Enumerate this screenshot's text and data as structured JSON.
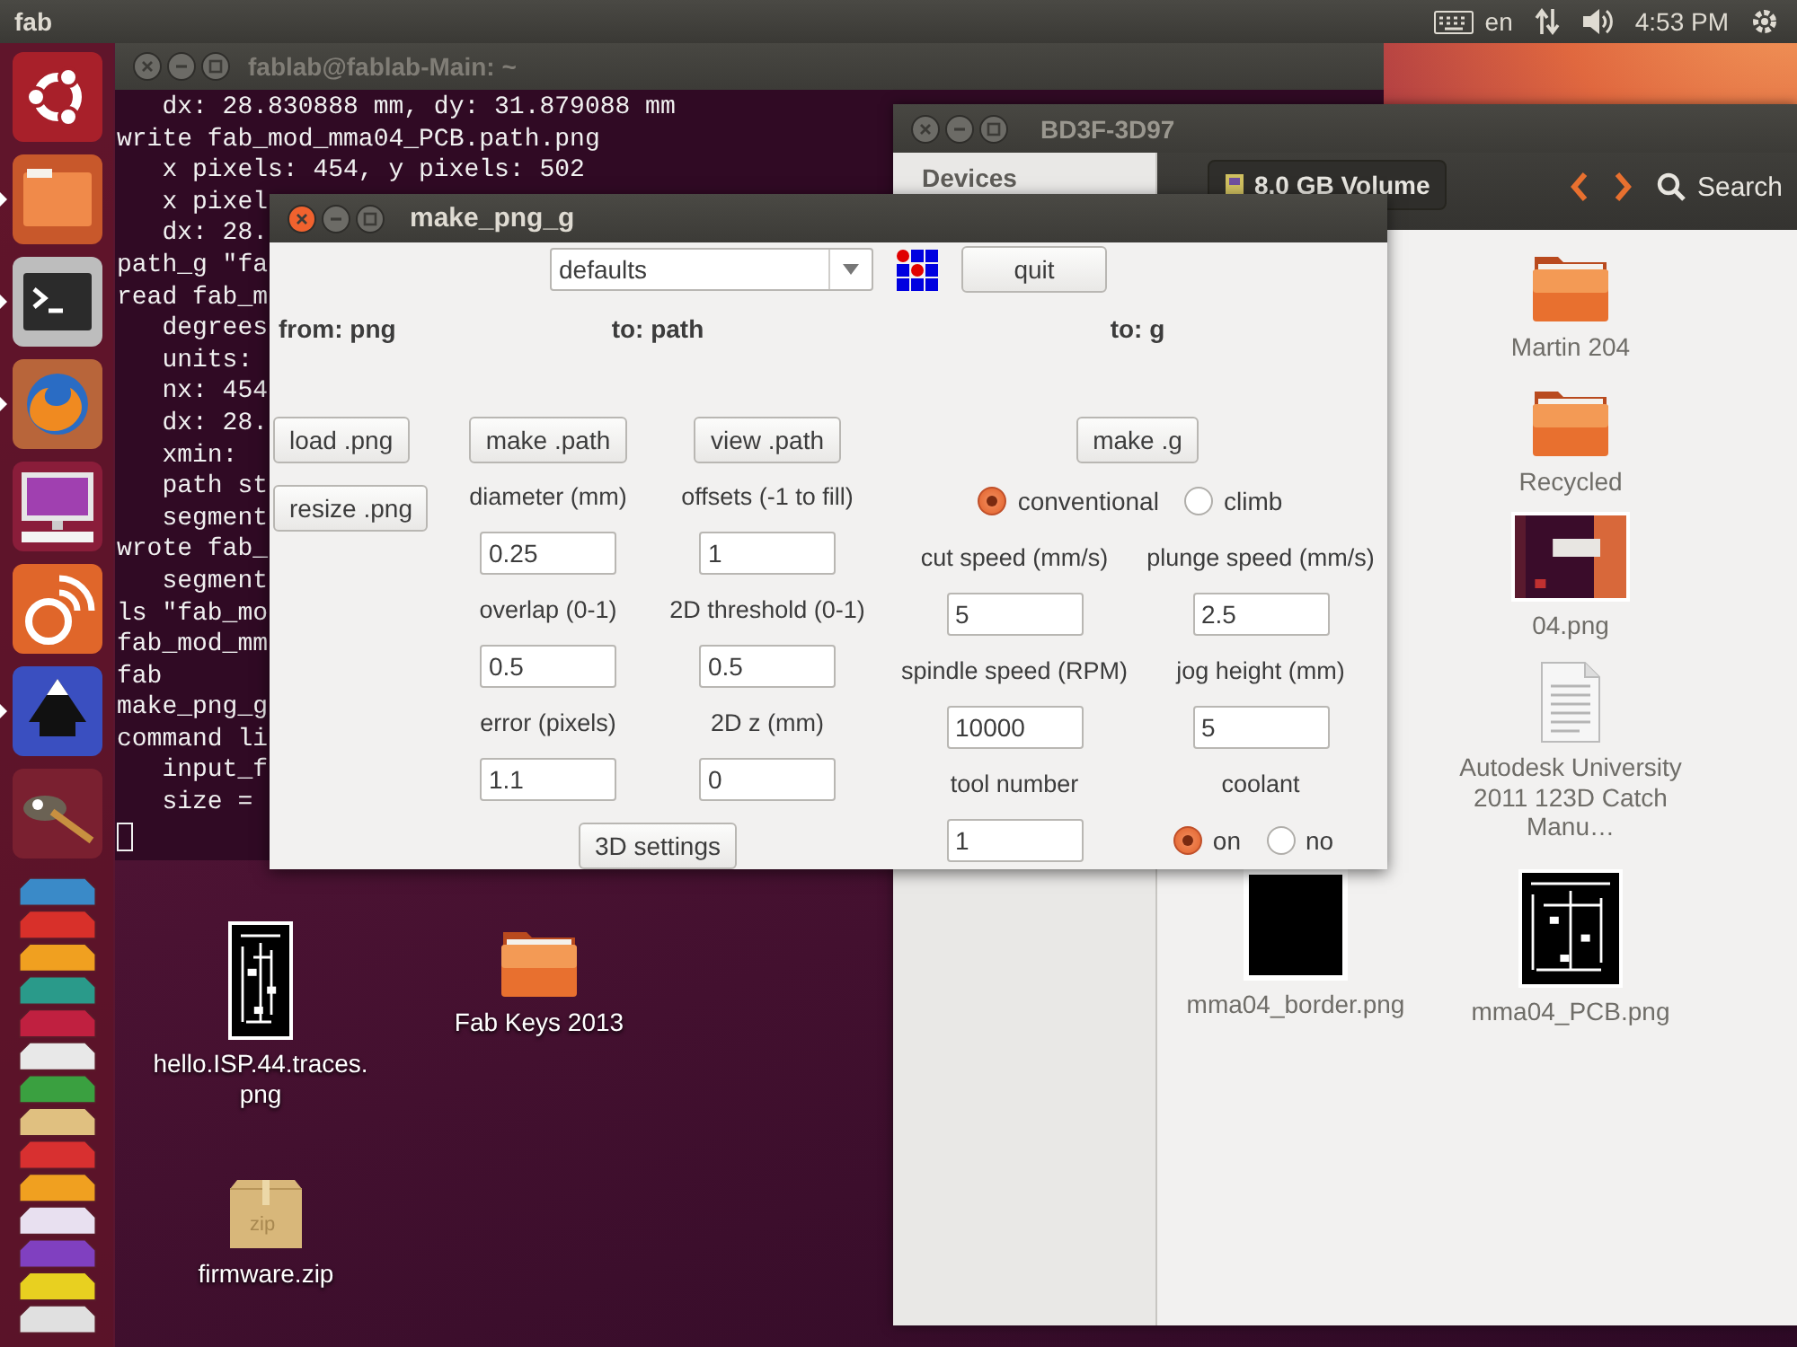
{
  "top_panel": {
    "title": "fab",
    "language": "en",
    "clock": "4:53 PM"
  },
  "launcher": [
    {
      "kind": "home",
      "running": false
    },
    {
      "kind": "files",
      "running": true
    },
    {
      "kind": "terminal",
      "running": true
    },
    {
      "kind": "browser",
      "running": true
    },
    {
      "kind": "display",
      "running": false
    },
    {
      "kind": "chat",
      "running": false
    },
    {
      "kind": "vector",
      "running": true
    },
    {
      "kind": "paint",
      "running": false
    }
  ],
  "terminal": {
    "title": "fablab@fablab-Main: ~",
    "lines": [
      "   dx: 28.830888 mm, dy: 31.879088 mm",
      "write fab_mod_mma04_PCB.path.png",
      "   x pixels: 454, y pixels: 502",
      "   x pixel",
      "   dx: 28.",
      "path_g \"fa",
      "read fab_m",
      "   degrees",
      "   units:",
      "   nx: 454",
      "   dx: 28.",
      "   xmin:",
      "   path st",
      "   segment",
      "wrote fab_",
      "   segment",
      "ls \"fab_mo",
      "fab_mod_mm",
      "fab",
      "make_png_g",
      "command li",
      "   input_f",
      "   size ="
    ]
  },
  "file_manager": {
    "title": "BD3F-3D97",
    "sidebar_heading": "Devices",
    "location": "8.0 GB Volume",
    "search": "Search",
    "items": [
      {
        "name": "Martin 204",
        "kind": "folder"
      },
      {
        "name": "Recycled",
        "kind": "folder"
      },
      {
        "name": "04.png",
        "kind": "screenshot"
      },
      {
        "name": "Autodesk University 2011 123D Catch Manu…",
        "kind": "document"
      },
      {
        "name": "mma04_border.png",
        "kind": "blank-image"
      },
      {
        "name": "mma04_PCB.png",
        "kind": "circuit-image"
      }
    ]
  },
  "dialog": {
    "title": "make_png_g",
    "preset": "defaults",
    "quit": "quit",
    "headers": [
      "from: png",
      "to: path",
      "to: g"
    ],
    "png_buttons": [
      "load .png",
      "resize .png"
    ],
    "path": {
      "buttons": [
        "make .path",
        "view .path"
      ],
      "fields": [
        {
          "label": "diameter (mm)",
          "value": "0.25"
        },
        {
          "label": "offsets (-1 to fill)",
          "value": "1"
        },
        {
          "label": "overlap (0-1)",
          "value": "0.5"
        },
        {
          "label": "2D threshold (0-1)",
          "value": "0.5"
        },
        {
          "label": "error (pixels)",
          "value": "1.1"
        },
        {
          "label": "2D z (mm)",
          "value": "0"
        }
      ],
      "settings_button": "3D settings"
    },
    "g": {
      "button": "make .g",
      "direction": [
        {
          "label": "conventional",
          "selected": true
        },
        {
          "label": "climb",
          "selected": false
        }
      ],
      "fields": [
        {
          "label": "cut speed (mm/s)",
          "value": "5"
        },
        {
          "label": "plunge speed (mm/s)",
          "value": "2.5"
        },
        {
          "label": "spindle speed (RPM)",
          "value": "10000"
        },
        {
          "label": "jog height (mm)",
          "value": "5"
        },
        {
          "label": "tool number",
          "value": "1"
        }
      ],
      "coolant": {
        "label": "coolant",
        "options": [
          {
            "label": "on",
            "selected": true
          },
          {
            "label": "no",
            "selected": false
          }
        ]
      }
    }
  },
  "desktop_icons": [
    {
      "name": "hello.ISP.44.traces.png",
      "kind": "circuit-image"
    },
    {
      "name": "Fab Keys 2013",
      "kind": "folder"
    },
    {
      "name": "firmware.zip",
      "kind": "archive",
      "badge": "zip"
    }
  ]
}
